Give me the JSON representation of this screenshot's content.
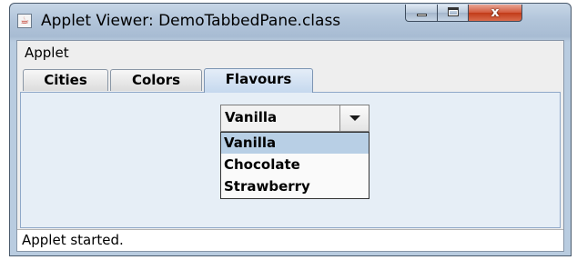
{
  "window": {
    "title": "Applet Viewer: DemoTabbedPane.class",
    "icon": "java-cup-icon",
    "controls": {
      "minimize": "minimize-icon",
      "maximize": "maximize-icon",
      "close_glyph": "x"
    }
  },
  "menubar": {
    "items": [
      {
        "label": "Applet"
      }
    ]
  },
  "tabs": [
    {
      "label": "Cities",
      "selected": false
    },
    {
      "label": "Colors",
      "selected": false
    },
    {
      "label": "Flavours",
      "selected": true
    }
  ],
  "flavour_combo": {
    "selected": "Vanilla",
    "options": [
      "Vanilla",
      "Chocolate",
      "Strawberry"
    ],
    "highlighted_option": "Vanilla",
    "arrow_icon": "chevron-down-icon"
  },
  "status": {
    "text": "Applet started."
  },
  "colors": {
    "title_bar": "#b2c5da",
    "close_button": "#c23b18",
    "selected_tab": "#c5d8ee",
    "highlight": "#b8cfe5"
  }
}
